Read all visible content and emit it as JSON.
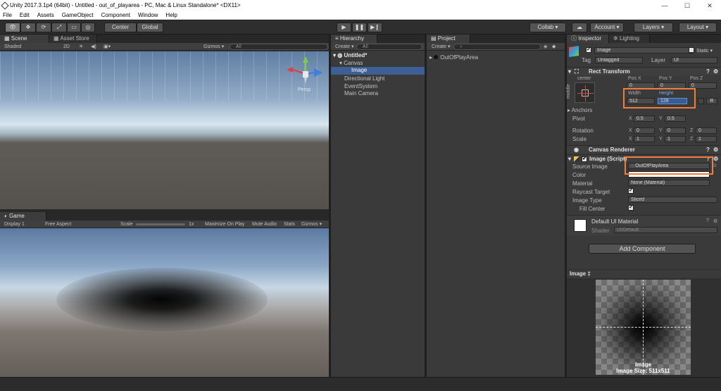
{
  "window": {
    "title": "Unity 2017.3.1p4 (64bit) - Untitled - out_of_playarea - PC, Mac & Linux Standalone* <DX11>",
    "min": "—",
    "max": "☐",
    "close": "✕"
  },
  "menu": [
    "File",
    "Edit",
    "Assets",
    "GameObject",
    "Component",
    "Window",
    "Help"
  ],
  "toolbar": {
    "pivot": "Center",
    "space": "Global",
    "collab": "Collab ▾",
    "account": "Account ▾",
    "layers": "Layers ▾",
    "layout": "Layout ▾"
  },
  "scene": {
    "tabs": [
      "Scene",
      "Asset Store"
    ],
    "shading": "Shaded",
    "mode2d": "2D",
    "gizmos": "Gizmos ▾",
    "search": "All",
    "persp": "Persp"
  },
  "game": {
    "tab": "Game",
    "display": "Display 1",
    "aspect": "Free Aspect",
    "scale_label": "Scale",
    "scale_value": "1x",
    "maximize": "Maximize On Play",
    "mute": "Mute Audio",
    "stats": "Stats",
    "gizmos": "Gizmos ▾"
  },
  "hierarchy": {
    "tab": "Hierarchy",
    "create": "Create ▾",
    "search": "All",
    "scene_name": "Untitled*",
    "items": [
      "Canvas",
      "Image",
      "Directional Light",
      "EventSystem",
      "Main Camera"
    ]
  },
  "project": {
    "tab": "Project",
    "create": "Create ▾",
    "items": [
      "OutOfPlayArea"
    ]
  },
  "inspector": {
    "tabs": [
      "Inspector",
      "Lighting"
    ],
    "object_name": "Image",
    "static_label": "Static ▾",
    "tag_label": "Tag",
    "tag_value": "Untagged",
    "layer_label": "Layer",
    "layer_value": "UI",
    "rect_transform": {
      "title": "Rect Transform",
      "anchor_h": "center",
      "anchor_v": "middle",
      "pos_x_label": "Pos X",
      "pos_y_label": "Pos Y",
      "pos_z_label": "Pos Z",
      "pos_x": "0",
      "pos_y": "0",
      "pos_z": "0",
      "width_label": "Width",
      "height_label": "Height",
      "width": "512",
      "height": "128",
      "r_button": "R",
      "anchors": "Anchors",
      "pivot_label": "Pivot",
      "pivot_x": "0.5",
      "pivot_y": "0.5",
      "rotation_label": "Rotation",
      "rot_x": "0",
      "rot_y": "0",
      "rot_z": "0",
      "scale_label": "Scale",
      "scale_x": "1",
      "scale_y": "1",
      "scale_z": "1"
    },
    "canvas_renderer": {
      "title": "Canvas Renderer"
    },
    "image_script": {
      "title": "Image (Script)",
      "source_label": "Source Image",
      "source_value": "OutOfPlayArea",
      "color_label": "Color",
      "material_label": "Material",
      "material_value": "None (Material)",
      "raycast_label": "Raycast Target",
      "type_label": "Image Type",
      "type_value": "Sliced",
      "fill_label": "Fill Center"
    },
    "default_material": {
      "title": "Default UI Material",
      "shader_label": "Shader",
      "shader_value": "UI/Default"
    },
    "add_component": "Add Component"
  },
  "preview": {
    "header": "Image ‡",
    "caption_name": "Image",
    "caption_size": "Image Size: 511x511"
  },
  "colors": {
    "highlight": "#ef7d3c",
    "panel": "#383838",
    "selected_field": "#3b5c8f"
  }
}
